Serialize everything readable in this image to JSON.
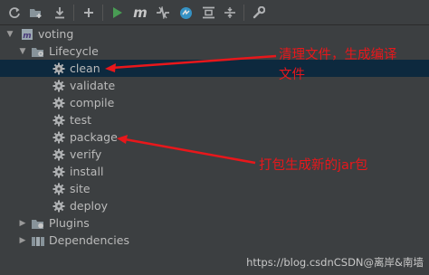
{
  "toolbar": {
    "buttons": [
      {
        "name": "reload-icon"
      },
      {
        "name": "add-folder-icon"
      },
      {
        "name": "download-icon"
      },
      {
        "name": "plus-icon"
      },
      {
        "name": "run-icon"
      },
      {
        "name": "maven-goal-icon",
        "glyph": "m"
      },
      {
        "name": "toggle-offline-icon"
      },
      {
        "name": "skip-tests-icon"
      },
      {
        "name": "show-dependencies-icon"
      },
      {
        "name": "collapse-all-icon"
      },
      {
        "name": "settings-wrench-icon"
      }
    ]
  },
  "tree": {
    "project": "voting",
    "lifecycle_label": "Lifecycle",
    "phases": [
      "clean",
      "validate",
      "compile",
      "test",
      "package",
      "verify",
      "install",
      "site",
      "deploy"
    ],
    "plugins_label": "Plugins",
    "dependencies_label": "Dependencies",
    "selected": "clean"
  },
  "annotations": {
    "clean_note_line1": "清理文件，生成编译",
    "clean_note_line2": "文件",
    "package_note": "打包生成新的jar包"
  },
  "watermark": "https://blog.csdnCSDN@离岸&南墙",
  "colors": {
    "background": "#3c3f41",
    "selection": "#0d293e",
    "annotation_red": "#e8171b",
    "run_green": "#499c54",
    "gear_gray": "#afb1b3"
  }
}
